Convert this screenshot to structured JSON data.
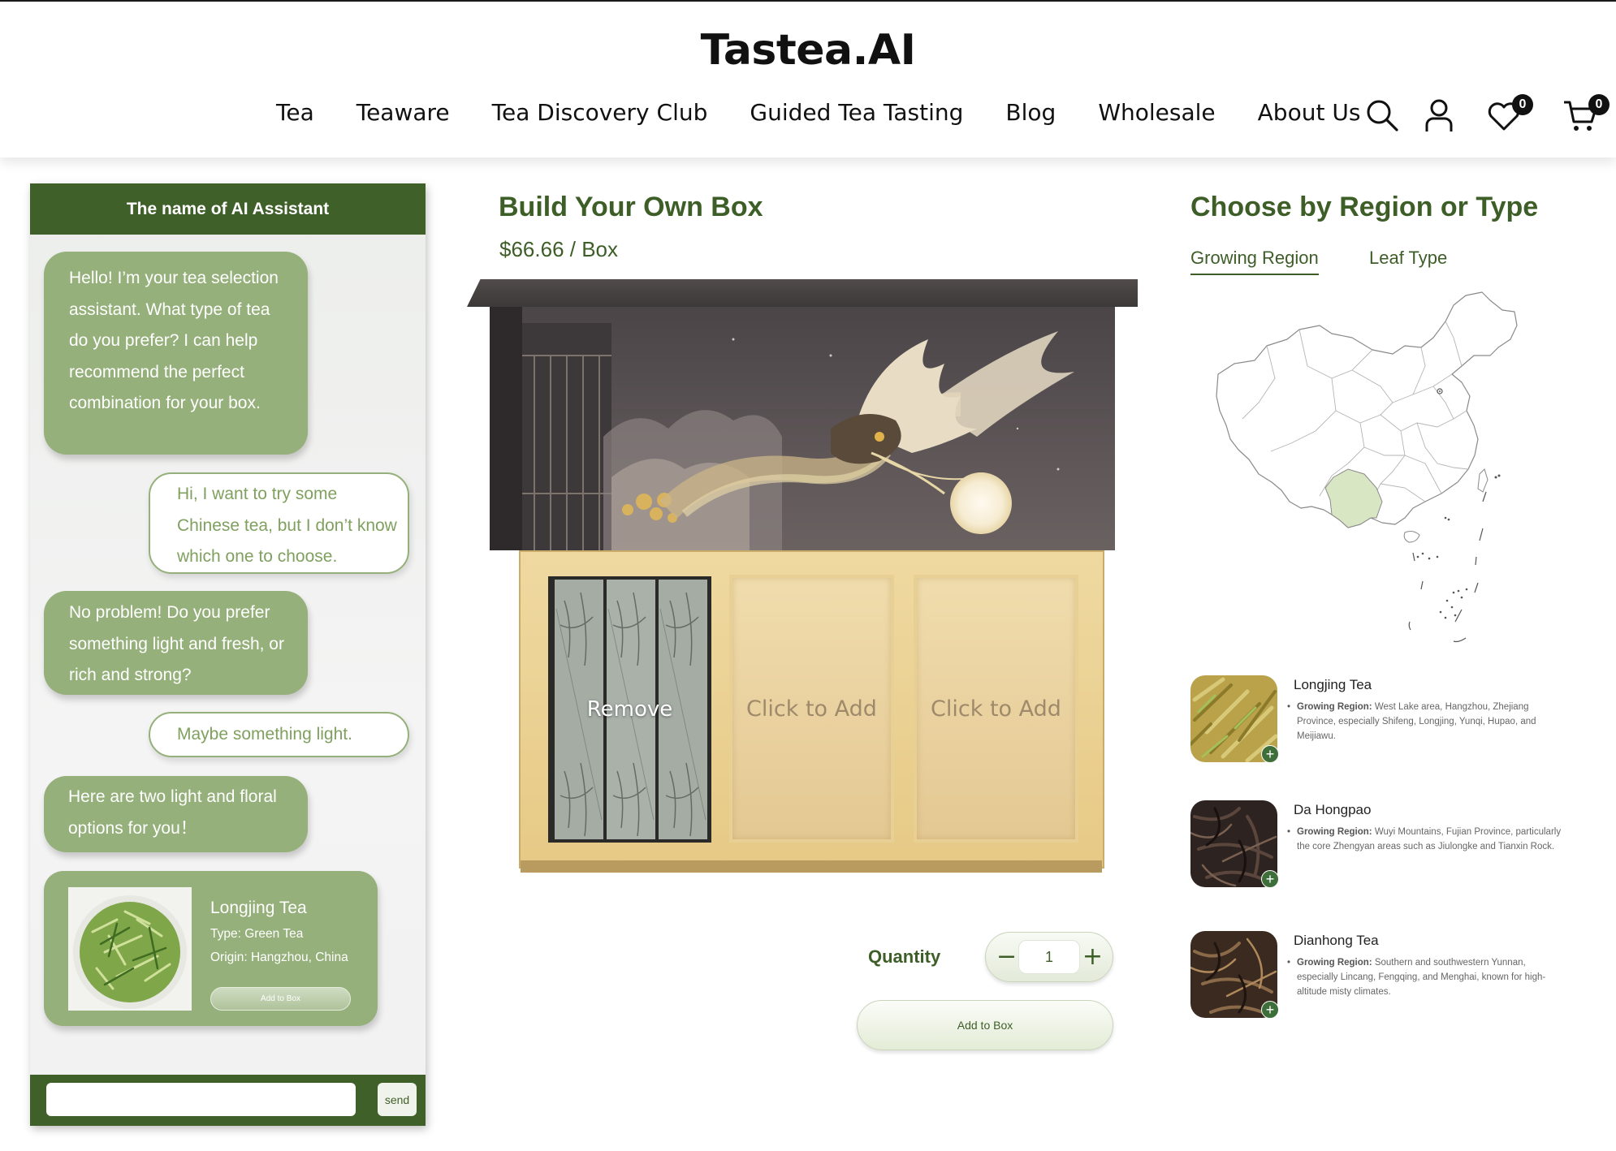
{
  "header": {
    "logo": "Tastea.AI",
    "nav": [
      "Tea",
      "Teaware",
      "Tea Discovery Club",
      "Guided Tea Tasting",
      "Blog",
      "Wholesale",
      "About Us"
    ],
    "wishlist_count": "0",
    "cart_count": "0",
    "icons": [
      "search-icon",
      "user-icon",
      "heart-icon",
      "cart-icon"
    ]
  },
  "chat": {
    "title": "The name of AI Assistant",
    "messages": [
      {
        "from": "ai",
        "text": "Hello! I’m your tea selection assistant. What type of tea do you prefer? I can help recommend the perfect combination for your box."
      },
      {
        "from": "user",
        "text": "Hi, I want to try some Chinese tea, but I don’t know which one to choose."
      },
      {
        "from": "ai",
        "text": "No problem! Do you prefer something light and fresh, or rich and strong?"
      },
      {
        "from": "user",
        "text": "Maybe something light."
      },
      {
        "from": "ai",
        "text": "Here are two light and floral options for you！"
      }
    ],
    "product": {
      "name": "Longjing Tea",
      "type": "Type: Green Tea",
      "origin": "Origin: Hangzhou, China",
      "button": "Add to Box"
    },
    "input_value": "",
    "send_label": "send"
  },
  "builder": {
    "title": "Build Your Own Box",
    "price": "$66.66 / Box",
    "slots": [
      {
        "state": "filled",
        "label": "Remove"
      },
      {
        "state": "empty",
        "label": "Click to Add"
      },
      {
        "state": "empty",
        "label": "Click to Add"
      }
    ],
    "quantity_label": "Quantity",
    "quantity": "1",
    "minus": "−",
    "plus": "+",
    "add_button": "Add to Box"
  },
  "region": {
    "title": "Choose by Region or Type",
    "tabs": [
      {
        "label": "Growing Region",
        "active": true
      },
      {
        "label": "Leaf Type",
        "active": false
      }
    ],
    "highlight_color": "#d9e6c4",
    "teas": [
      {
        "name": "Longjing Tea",
        "label": "Growing Region:",
        "desc": "West Lake area, Hangzhou, Zhejiang Province, especially Shifeng, Longjing, Yunqi, Hupao, and Meijiawu."
      },
      {
        "name": "Da Hongpao",
        "label": "Growing Region:",
        "desc": "Wuyi Mountains, Fujian Province, particularly the core Zhengyan areas such as Jiulongke and Tianxin Rock."
      },
      {
        "name": "Dianhong Tea",
        "label": "Growing Region:",
        "desc": "Southern and southwestern Yunnan, especially Lincang, Fengqing, and Menghai, known for high-altitude misty climates."
      }
    ]
  },
  "colors": {
    "brand_green": "#40602a",
    "bubble_green": "#95b07a",
    "text_green": "#3e5e28"
  }
}
